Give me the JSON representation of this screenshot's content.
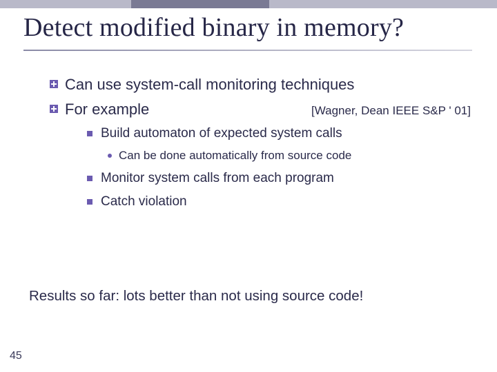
{
  "slide": {
    "title": "Detect modified binary in memory?",
    "page_number": "45",
    "summary": "Results so far: lots better than not using source code!",
    "points": {
      "p1": "Can use system-call monitoring techniques",
      "p2": "For example",
      "p2_cite": "[Wagner, Dean IEEE S&P ' 01]",
      "sub1": "Build automaton of expected system calls",
      "sub1a": "Can be done automatically from source code",
      "sub2": "Monitor system calls from each program",
      "sub3": "Catch violation"
    }
  }
}
